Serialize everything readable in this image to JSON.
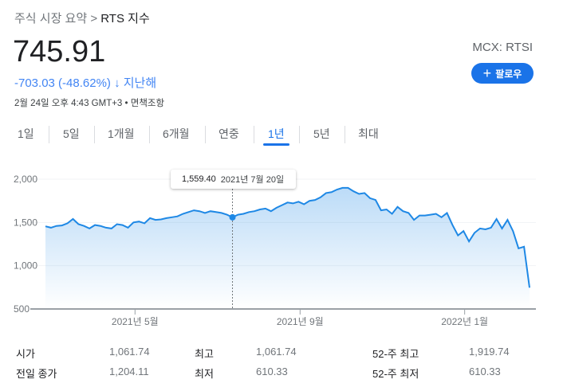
{
  "breadcrumb": {
    "parent": "주식 시장 요약",
    "sep": ">",
    "current": "RTS 지수"
  },
  "price": "745.91",
  "change": {
    "text": "-703.03 (-48.62%)",
    "arrow": "↓",
    "period": "지난해"
  },
  "meta": "2월 24일 오후 4:43 GMT+3 • 면책조항",
  "ticker": "MCX: RTSI",
  "follow": {
    "icon": "plus-icon",
    "label": "팔로우"
  },
  "tabs": [
    {
      "label": "1일"
    },
    {
      "label": "5일"
    },
    {
      "label": "1개월"
    },
    {
      "label": "6개월"
    },
    {
      "label": "연중"
    },
    {
      "label": "1년",
      "active": true
    },
    {
      "label": "5년"
    },
    {
      "label": "최대"
    }
  ],
  "colors": {
    "accent": "#1a73e8",
    "line": "#1e88e5",
    "negative": "#4285f4"
  },
  "tooltip": {
    "value": "1,559.40",
    "date": "2021년 7월 20일"
  },
  "chart_data": {
    "type": "area",
    "ylim": [
      500,
      2000
    ],
    "yticks": [
      "2,000",
      "1,500",
      "1,000",
      "500"
    ],
    "ytick_values": [
      2000,
      1500,
      1000,
      500
    ],
    "xticks": [
      {
        "label": "2021년 5월",
        "frac": 0.185
      },
      {
        "label": "2021년 9월",
        "frac": 0.526
      },
      {
        "label": "2022년 1월",
        "frac": 0.866
      }
    ],
    "highlight_index": 34,
    "values": [
      1455,
      1440,
      1460,
      1465,
      1490,
      1540,
      1480,
      1460,
      1430,
      1470,
      1460,
      1440,
      1430,
      1480,
      1470,
      1440,
      1500,
      1510,
      1490,
      1550,
      1530,
      1535,
      1550,
      1560,
      1570,
      1600,
      1620,
      1640,
      1630,
      1610,
      1630,
      1620,
      1610,
      1590,
      1559.4,
      1590,
      1600,
      1620,
      1630,
      1650,
      1660,
      1630,
      1670,
      1700,
      1730,
      1720,
      1740,
      1710,
      1750,
      1760,
      1790,
      1840,
      1850,
      1880,
      1900,
      1900,
      1860,
      1830,
      1840,
      1780,
      1760,
      1640,
      1650,
      1600,
      1680,
      1630,
      1610,
      1530,
      1580,
      1580,
      1590,
      1600,
      1560,
      1610,
      1470,
      1350,
      1400,
      1280,
      1380,
      1430,
      1420,
      1440,
      1540,
      1430,
      1530,
      1400,
      1200,
      1220,
      745.91
    ]
  },
  "stats": [
    {
      "label": "시가",
      "value": "1,061.74"
    },
    {
      "label": "최고",
      "value": "1,061.74"
    },
    {
      "label": "52-주 최고",
      "value": "1,919.74"
    },
    {
      "label": "전일 종가",
      "value": "1,204.11"
    },
    {
      "label": "최저",
      "value": "610.33"
    },
    {
      "label": "52-주 최저",
      "value": "610.33"
    }
  ]
}
